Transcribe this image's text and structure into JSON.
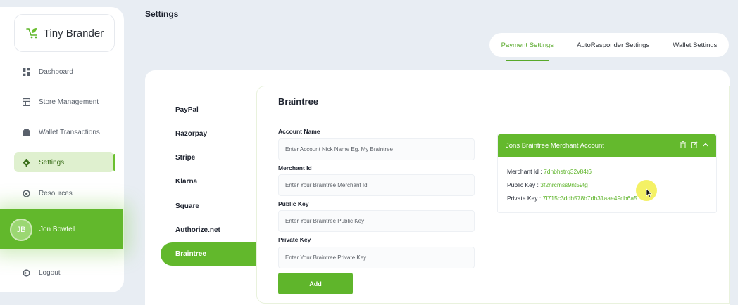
{
  "brand": {
    "name": "Tiny Brander",
    "accent": "#62b82c"
  },
  "sidebar": {
    "items": [
      {
        "label": "Dashboard",
        "icon": "dashboard-icon"
      },
      {
        "label": "Store Management",
        "icon": "store-icon"
      },
      {
        "label": "Wallet Transactions",
        "icon": "wallet-icon"
      },
      {
        "label": "Settings",
        "icon": "gear-icon",
        "active": true
      },
      {
        "label": "Resources",
        "icon": "resources-icon"
      }
    ],
    "user": {
      "initials": "JB",
      "name": "Jon Bowtell"
    },
    "logout": "Logout"
  },
  "page": {
    "title": "Settings"
  },
  "tabs": [
    {
      "label": "Payment Settings",
      "active": true
    },
    {
      "label": "AutoResponder Settings"
    },
    {
      "label": "Wallet Settings"
    }
  ],
  "gateways": [
    "PayPal",
    "Razorpay",
    "Stripe",
    "Klarna",
    "Square",
    "Authorize.net",
    "Braintree"
  ],
  "active_gateway": "Braintree",
  "form": {
    "title": "Braintree",
    "fields": [
      {
        "label": "Account Name",
        "placeholder": "Enter Account Nick Name Eg. My Braintree"
      },
      {
        "label": "Merchant Id",
        "placeholder": "Enter Your Braintree Merchant Id"
      },
      {
        "label": "Public Key",
        "placeholder": "Enter Your Braintree Public Key"
      },
      {
        "label": "Private Key",
        "placeholder": "Enter Your Braintree Private Key"
      }
    ],
    "submit": "Add"
  },
  "account": {
    "title": "Jons Braintree Merchant Account",
    "merchant_label": "Merchant Id :",
    "merchant_value": "7dnbhstrq32v84t6",
    "public_label": "Public Key :",
    "public_value": "3f2nrcmss9nt59tg",
    "private_label": "Private Key :",
    "private_value": "7f715c3ddb578b7db31aae49db6a5"
  }
}
